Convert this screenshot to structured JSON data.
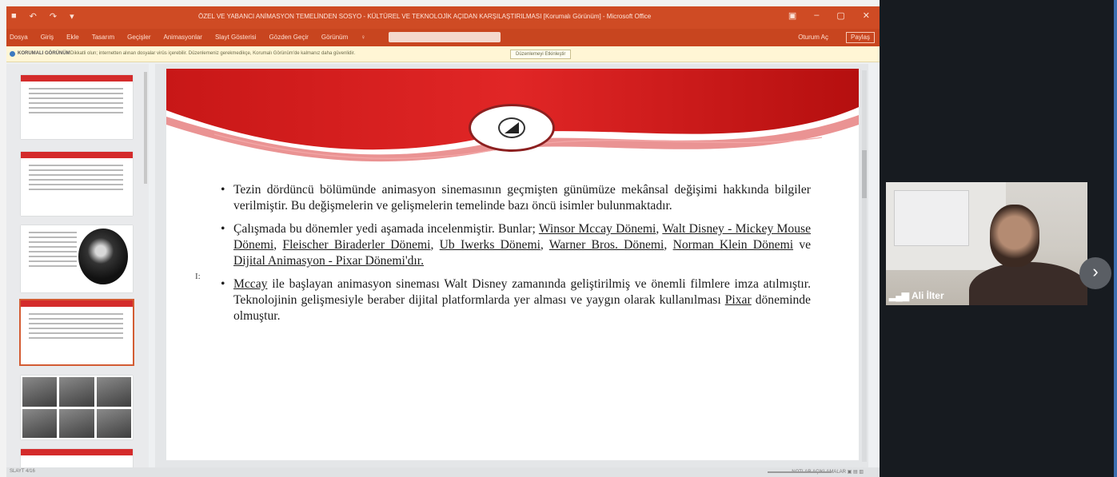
{
  "window": {
    "title": "ÖZEL VE YABANCI ANİMASYON TEMELİNDEN SOSYO - KÜLTÜREL VE TEKNOLOJİK AÇIDAN KARŞILAŞTIRILMASI [Korumalı Görünüm] - Microsoft Office",
    "quick_access": [
      "■",
      "↶",
      "↷",
      "▾"
    ],
    "controls": [
      "▣",
      "–",
      "▢",
      "✕"
    ]
  },
  "menu": {
    "items": [
      "Dosya",
      "Giriş",
      "Ekle",
      "Tasarım",
      "Geçişler",
      "Animasyonlar",
      "Slayt Gösterisi",
      "Gözden Geçir",
      "Görünüm",
      "♀"
    ],
    "user": "Oturum Aç",
    "share": "Paylaş"
  },
  "protected_bar": {
    "label": "KORUMALI GÖRÜNÜM",
    "message": "Dikkatli olun; internetten alınan dosyalar virüs içerebilir. Düzenlemeniz gerekmedikçe, Korumalı Görünüm'de kalmanız daha güvenlidir.",
    "button": "Düzenlemeyi Etkinleştir"
  },
  "slide": {
    "marker": "I:",
    "bullet1": "Tezin dördüncü bölümünde animasyon sinemasının geçmişten günümüze mekânsal değişimi hakkında bilgiler verilmiştir. Bu değişmelerin ve gelişmelerin temelinde bazı öncü isimler bulunmaktadır.",
    "bullet2": {
      "lead": "Çalışmada bu dönemler yedi aşamada incelenmiştir. Bunlar;",
      "p1": "Winsor Mccay Dönemi",
      "p2": "Walt Disney - Mickey Mouse Dönemi",
      "p3": "Fleischer Biraderler Dönemi",
      "p4": "Ub Iwerks Dönemi",
      "p5": "Warner Bros. Dönemi",
      "p6": "Norman Klein Dönemi",
      "p7": "Dijital Animasyon - Pixar Dönemi",
      "tail": "'dır."
    },
    "bullet3": {
      "mccay": "Mccay",
      "text1": "ile başlayan animasyon sineması Walt Disney zamanında geliştirilmiş ve önemli filmlere imza atılmıştır. Teknolojinin gelişmesiyle beraber dijital platformlarda yer alması ve yaygın olarak kullanılması",
      "pixar": "Pixar",
      "text2": "döneminde olmuştur."
    }
  },
  "status": {
    "left": "SLAYT 4/16",
    "right": "NOTLAR   AÇIKLAMALAR   ▣   ▤   ▥"
  },
  "participant": {
    "name": "Ali İlter",
    "signal_icon": "signal-bars-icon"
  },
  "nav": {
    "next": "›"
  }
}
